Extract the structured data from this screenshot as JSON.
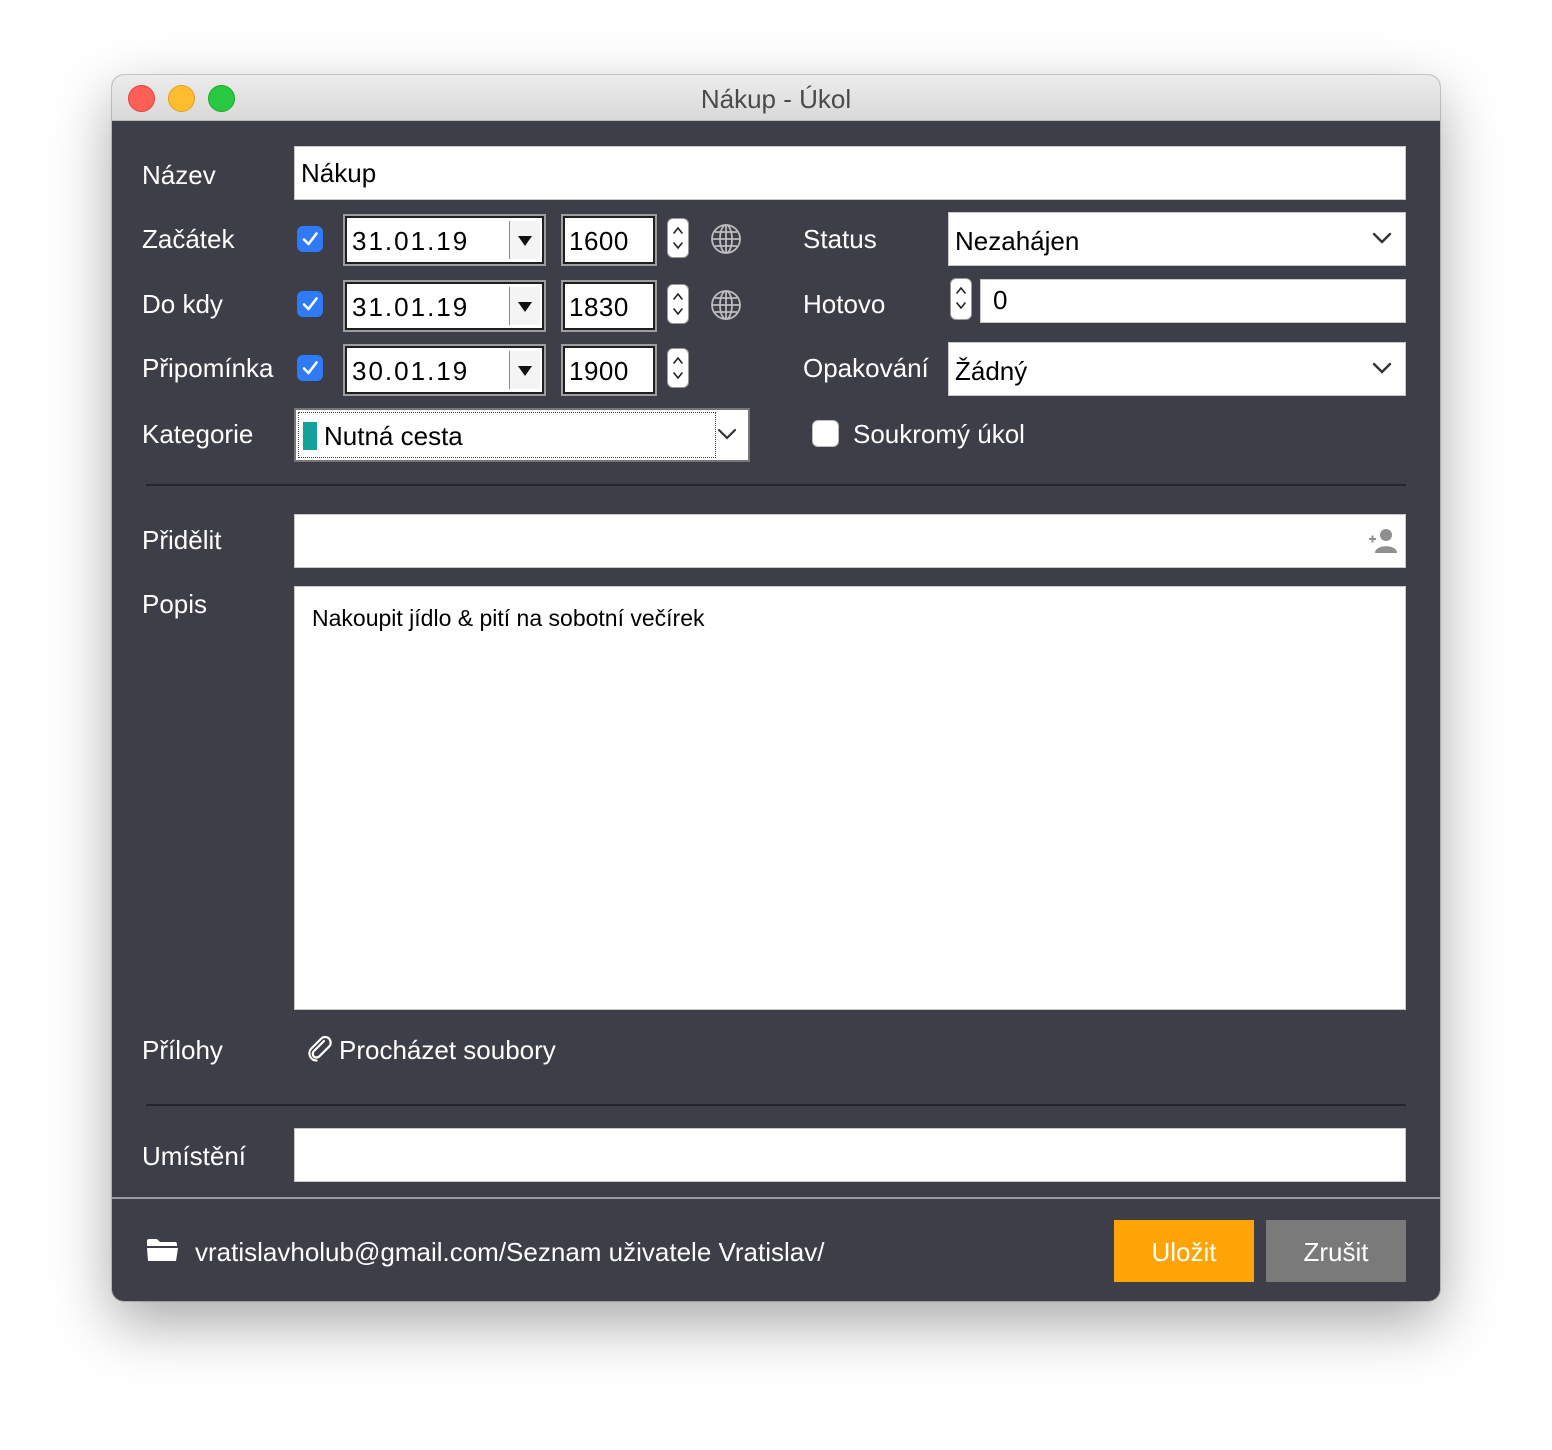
{
  "window": {
    "title": "Nákup - Úkol"
  },
  "labels": {
    "name": "Název",
    "start": "Začátek",
    "due": "Do kdy",
    "reminder": "Připomínka",
    "category": "Kategorie",
    "status": "Status",
    "done": "Hotovo",
    "repeat": "Opakování",
    "private": "Soukromý úkol",
    "assign": "Přidělit",
    "description": "Popis",
    "attachments": "Přílohy",
    "location": "Umístění"
  },
  "fields": {
    "name": "Nákup",
    "start_date": "31.01.19",
    "start_time": "1600",
    "due_date": "31.01.19",
    "due_time": "1830",
    "reminder_date": "30.01.19",
    "reminder_time": "1900",
    "status": "Nezahájen",
    "done": "0",
    "repeat": "Žádný",
    "category": "Nutná cesta",
    "assign": "",
    "description": "Nakoupit jídlo & pití na sobotní večírek",
    "location": ""
  },
  "checks": {
    "start": true,
    "due": true,
    "reminder": true,
    "private": false
  },
  "attachments": {
    "browse_label": "Procházet soubory"
  },
  "footer": {
    "path": "vratislavholub@gmail.com/Seznam uživatele Vratislav/",
    "save_label": "Uložit",
    "cancel_label": "Zrušit"
  },
  "colors": {
    "window_bg": "#3d3e47",
    "checkbox": "#2f7bf6",
    "category_swatch": "#12a29a",
    "save_button": "#fea406",
    "cancel_button": "#7a7a7a"
  },
  "icons": [
    "globe-icon",
    "stepper-icon",
    "chevron-down-icon",
    "add-person-icon",
    "paperclip-icon",
    "folder-icon"
  ]
}
